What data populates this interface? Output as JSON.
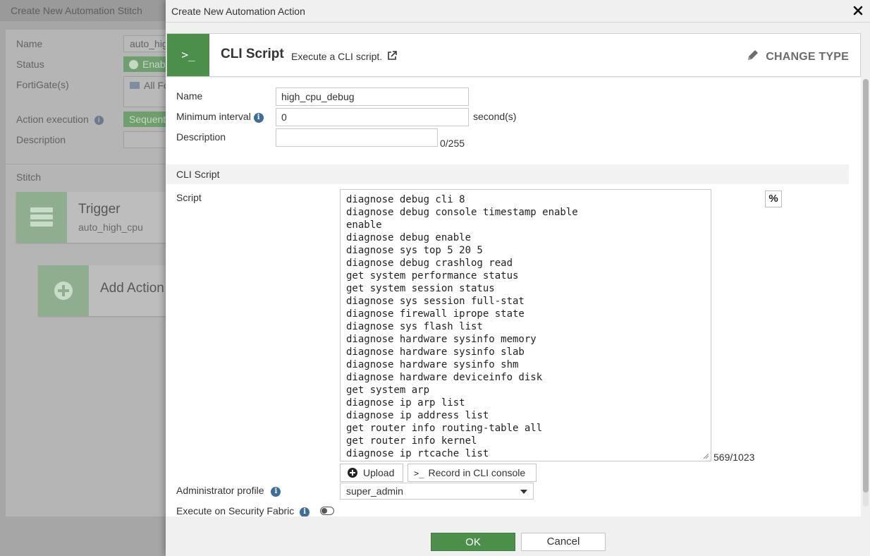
{
  "background": {
    "title": "Create New Automation Stitch",
    "name_label": "Name",
    "name_value": "auto_high_cpu",
    "status_label": "Status",
    "status_value": "Enabled",
    "fortigates_label": "FortiGate(s)",
    "fortigates_value": "All FortiGates",
    "action_execution_label": "Action execution",
    "action_execution_value": "Sequential",
    "description_label": "Description",
    "stitch_label": "Stitch",
    "trigger_title": "Trigger",
    "trigger_subtitle": "auto_high_cpu",
    "add_action_label": "Add Action"
  },
  "modal": {
    "title": "Create New Automation Action",
    "type_icon": "terminal-icon",
    "type_icon_glyph": ">_",
    "type_name": "CLI Script",
    "type_description": "Execute a CLI script.",
    "change_type_label": "CHANGE TYPE",
    "name_label": "Name",
    "name_value": "high_cpu_debug",
    "min_interval_label": "Minimum interval",
    "min_interval_value": "0",
    "min_interval_unit": "second(s)",
    "description_label": "Description",
    "description_value": "",
    "description_count": "0/255",
    "section_cli_script": "CLI Script",
    "script_label": "Script",
    "script_lines": [
      "diagnose debug cli 8",
      "diagnose debug console timestamp enable",
      "enable",
      "diagnose debug enable",
      "diagnose sys top 5 20 5",
      "diagnose debug crashlog read",
      "get system performance status",
      "get system session status",
      "diagnose sys session full-stat",
      "diagnose firewall iprope state",
      "diagnose sys flash list",
      "diagnose hardware sysinfo memory",
      "diagnose hardware sysinfo slab",
      "diagnose hardware sysinfo shm",
      "diagnose hardware deviceinfo disk",
      "get system arp",
      "diagnose ip arp list",
      "diagnose ip address list",
      "get router info routing-table all",
      "get router info kernel",
      "diagnose ip rtcache list"
    ],
    "script_count": "569/1023",
    "percent_button": "%",
    "upload_label": "Upload",
    "record_label": "Record in CLI console",
    "admin_profile_label": "Administrator profile",
    "admin_profile_value": "super_admin",
    "execute_fabric_label": "Execute on Security Fabric",
    "execute_fabric_enabled": false,
    "ok_label": "OK",
    "cancel_label": "Cancel"
  },
  "colors": {
    "accent_green": "#4b8f4b",
    "info_blue": "#3e6e9c"
  }
}
